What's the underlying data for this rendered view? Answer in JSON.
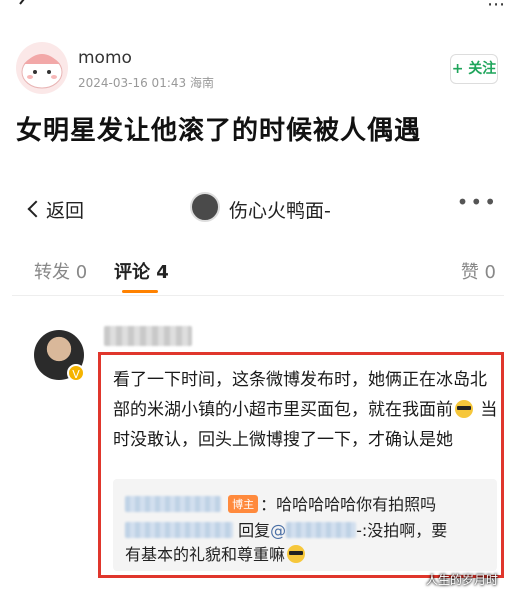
{
  "post": {
    "username": "momo",
    "timestamp": "2024-03-16 01:43",
    "location": "海南",
    "follow_label": "+ 关注",
    "title": "女明星发让他滚了的时候被人偶遇"
  },
  "screenshot": {
    "back_label": "返回",
    "title": "伤心火鸭面-",
    "more": "•••",
    "tabs": {
      "repost": "转发 0",
      "comment": "评论 4",
      "like": "赞 0"
    },
    "comment": {
      "text_part1": "看了一下时间，这条微博发布时，她俩正在冰岛北部的米湖小镇的小超市里买面包，就在我面前",
      "text_part2": "当时没敢认，回头上微博搜了一下，才确认是她",
      "emoji_icon": "sunglasses-emoji"
    },
    "replies": {
      "badge": "博主",
      "reply1_text": "：哈哈哈哈哈你有拍照吗",
      "reply2_prefix": "回复",
      "reply2_at": "@",
      "reply2_text": "-:没拍啊，要有基本的礼貌和尊重嘛"
    }
  },
  "watermark": "人生的岁月时",
  "colors": {
    "accent": "#ff8200",
    "highlight_border": "#e0362c",
    "follow": "#1fa55b"
  }
}
